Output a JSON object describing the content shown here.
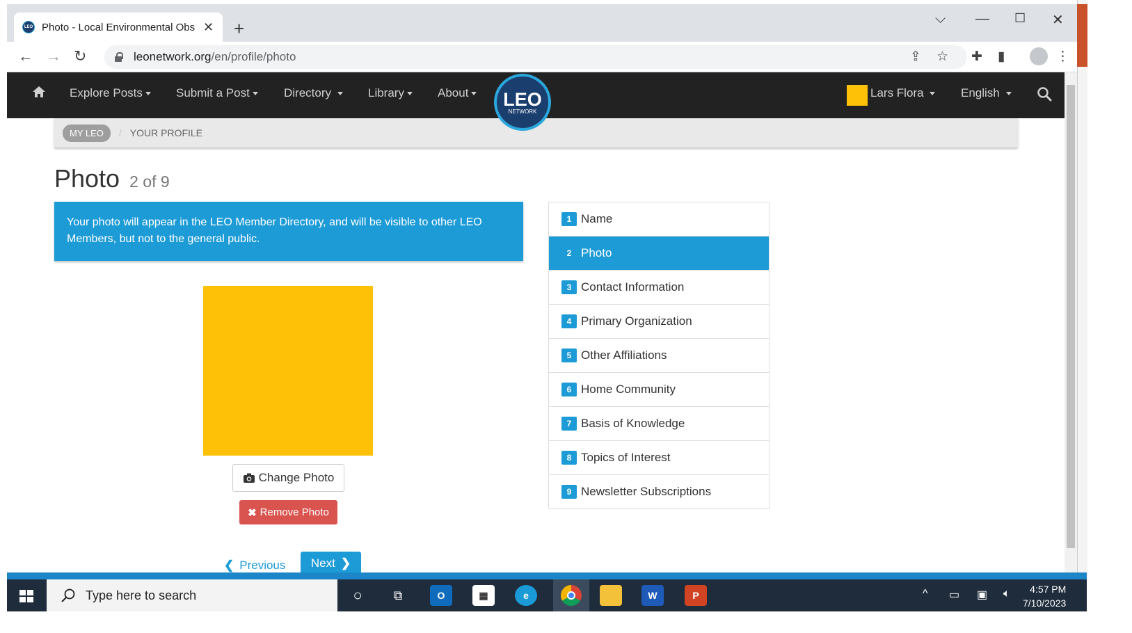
{
  "browser": {
    "tab_title": "Photo - Local Environmental Obs",
    "favicon_text": "LEO",
    "new_tab": "+",
    "url_host": "leonetwork.org",
    "url_path": "/en/profile/photo"
  },
  "nav": {
    "items": [
      {
        "label": "Explore Posts"
      },
      {
        "label": "Submit a Post"
      },
      {
        "label": "Directory"
      },
      {
        "label": "Library"
      },
      {
        "label": "About"
      }
    ],
    "logo_big": "LEO",
    "logo_small": "NETWORK",
    "user_name": "Lars Flora",
    "language": "English",
    "user_color": "#ffc107"
  },
  "breadcrumb": {
    "home": "MY LEO",
    "current": "YOUR PROFILE"
  },
  "page": {
    "title": "Photo",
    "step_text": "2 of 9",
    "info": "Your photo will appear in the LEO Member Directory, and will be visible to other LEO Members, but not to the general public.",
    "change_photo": "Change Photo",
    "remove_photo": "Remove Photo",
    "previous": "Previous",
    "next": "Next",
    "photo_color": "#ffc107"
  },
  "steps": [
    {
      "num": "1",
      "label": "Name"
    },
    {
      "num": "2",
      "label": "Photo"
    },
    {
      "num": "3",
      "label": "Contact Information"
    },
    {
      "num": "4",
      "label": "Primary Organization"
    },
    {
      "num": "5",
      "label": "Other Affiliations"
    },
    {
      "num": "6",
      "label": "Home Community"
    },
    {
      "num": "7",
      "label": "Basis of Knowledge"
    },
    {
      "num": "8",
      "label": "Topics of Interest"
    },
    {
      "num": "9",
      "label": "Newsletter Subscriptions"
    }
  ],
  "active_step": 2,
  "taskbar": {
    "search_placeholder": "Type here to search",
    "time": "4:57 PM",
    "date": "7/10/2023"
  },
  "colors": {
    "accent": "#1d9bd7",
    "danger": "#d9534f",
    "navbar": "#222222"
  }
}
